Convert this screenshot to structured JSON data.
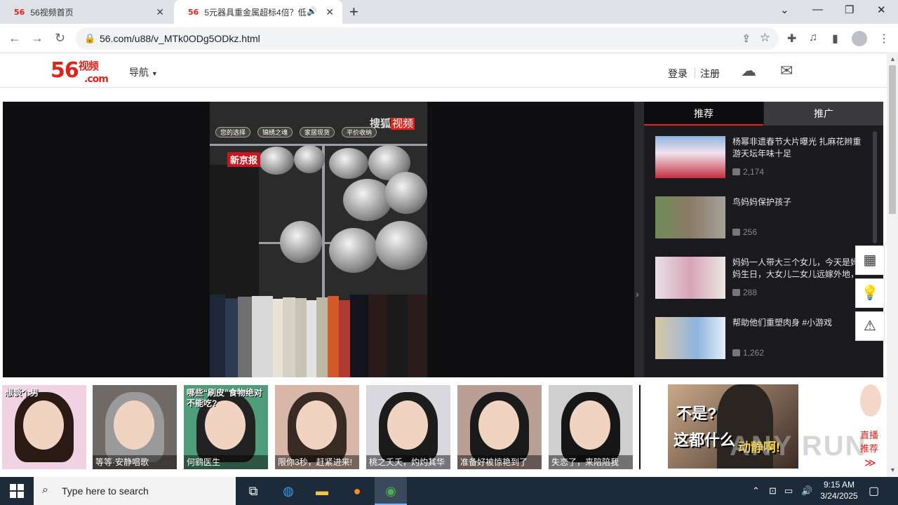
{
  "browser": {
    "tabs": [
      {
        "favicon": "56",
        "title": "56视频首页"
      },
      {
        "favicon": "56",
        "title": "5元器具重金属超标4倍？低"
      }
    ],
    "url": "56.com/u88/v_MTk0ODg5ODkz.html",
    "new_tab_symbol": "+"
  },
  "site": {
    "logo_main": "56",
    "logo_sub": "视频",
    "logo_domain": ".com",
    "nav_label": "导航",
    "login": "登录",
    "register": "注册"
  },
  "video": {
    "watermark_prefix": "搜狐",
    "watermark_brand": "视频",
    "source_badge": "新京报",
    "top_buttons": [
      "您的选择",
      "锦绣之魂",
      "家居现货",
      "平价收纳"
    ]
  },
  "sidebar": {
    "tabs": [
      "推荐",
      "推广"
    ],
    "items": [
      {
        "title": "杨幂非遗春节大片曝光 扎麻花辫重游天坛年味十足",
        "count": "2,174"
      },
      {
        "title": "鸟妈妈保护孩子",
        "count": "256"
      },
      {
        "title": "妈妈一人带大三个女儿，今天是妈妈生日，大女儿二女儿远嫁外地，",
        "count": "288"
      },
      {
        "title": "帮助他们重塑肉身 #小游戏",
        "count": "1,262"
      }
    ]
  },
  "ads": {
    "cards": [
      {
        "caption": "",
        "hair": "#2b1a14",
        "bg": "#f0d2e2",
        "tag": "想谈个男"
      },
      {
        "caption": "等等·安静唱歌",
        "hair": "#9a9a9a",
        "bg": "#6f6a66",
        "tag": ""
      },
      {
        "caption": "何鹞医生",
        "hair": "#222222",
        "bg": "#4f9d7a",
        "tag": "哪些“刷皮”食物绝对不能吃?"
      },
      {
        "caption": "限你3秒，赶紧进来!",
        "hair": "#3a2a24",
        "bg": "#d9b7a8",
        "tag": ""
      },
      {
        "caption": "桃之夭夭，灼灼其华",
        "hair": "#1c1c1c",
        "bg": "#d8d8de",
        "tag": ""
      },
      {
        "caption": "准备好被惊艳到了",
        "hair": "#1a1a1a",
        "bg": "#b99f95",
        "tag": ""
      },
      {
        "caption": "失恋了，来陪陪我",
        "hair": "#161616",
        "bg": "#cfcfcf",
        "tag": ""
      }
    ],
    "big_ad": {
      "line1": "不是?",
      "line2": "这都什么",
      "line3": "动静啊!"
    },
    "live": {
      "line1": "直播",
      "line2": "推荐",
      "arrows": "≫"
    },
    "watermark": "ANY RUN"
  },
  "taskbar": {
    "search_placeholder": "Type here to search",
    "time": "9:15 AM",
    "date": "3/24/2025"
  },
  "colors": {
    "brand": "#e0241b",
    "player_bg": "#0f0f12",
    "sidebar_bg": "#1b1b1f",
    "taskbar": "#1c2a3a"
  }
}
